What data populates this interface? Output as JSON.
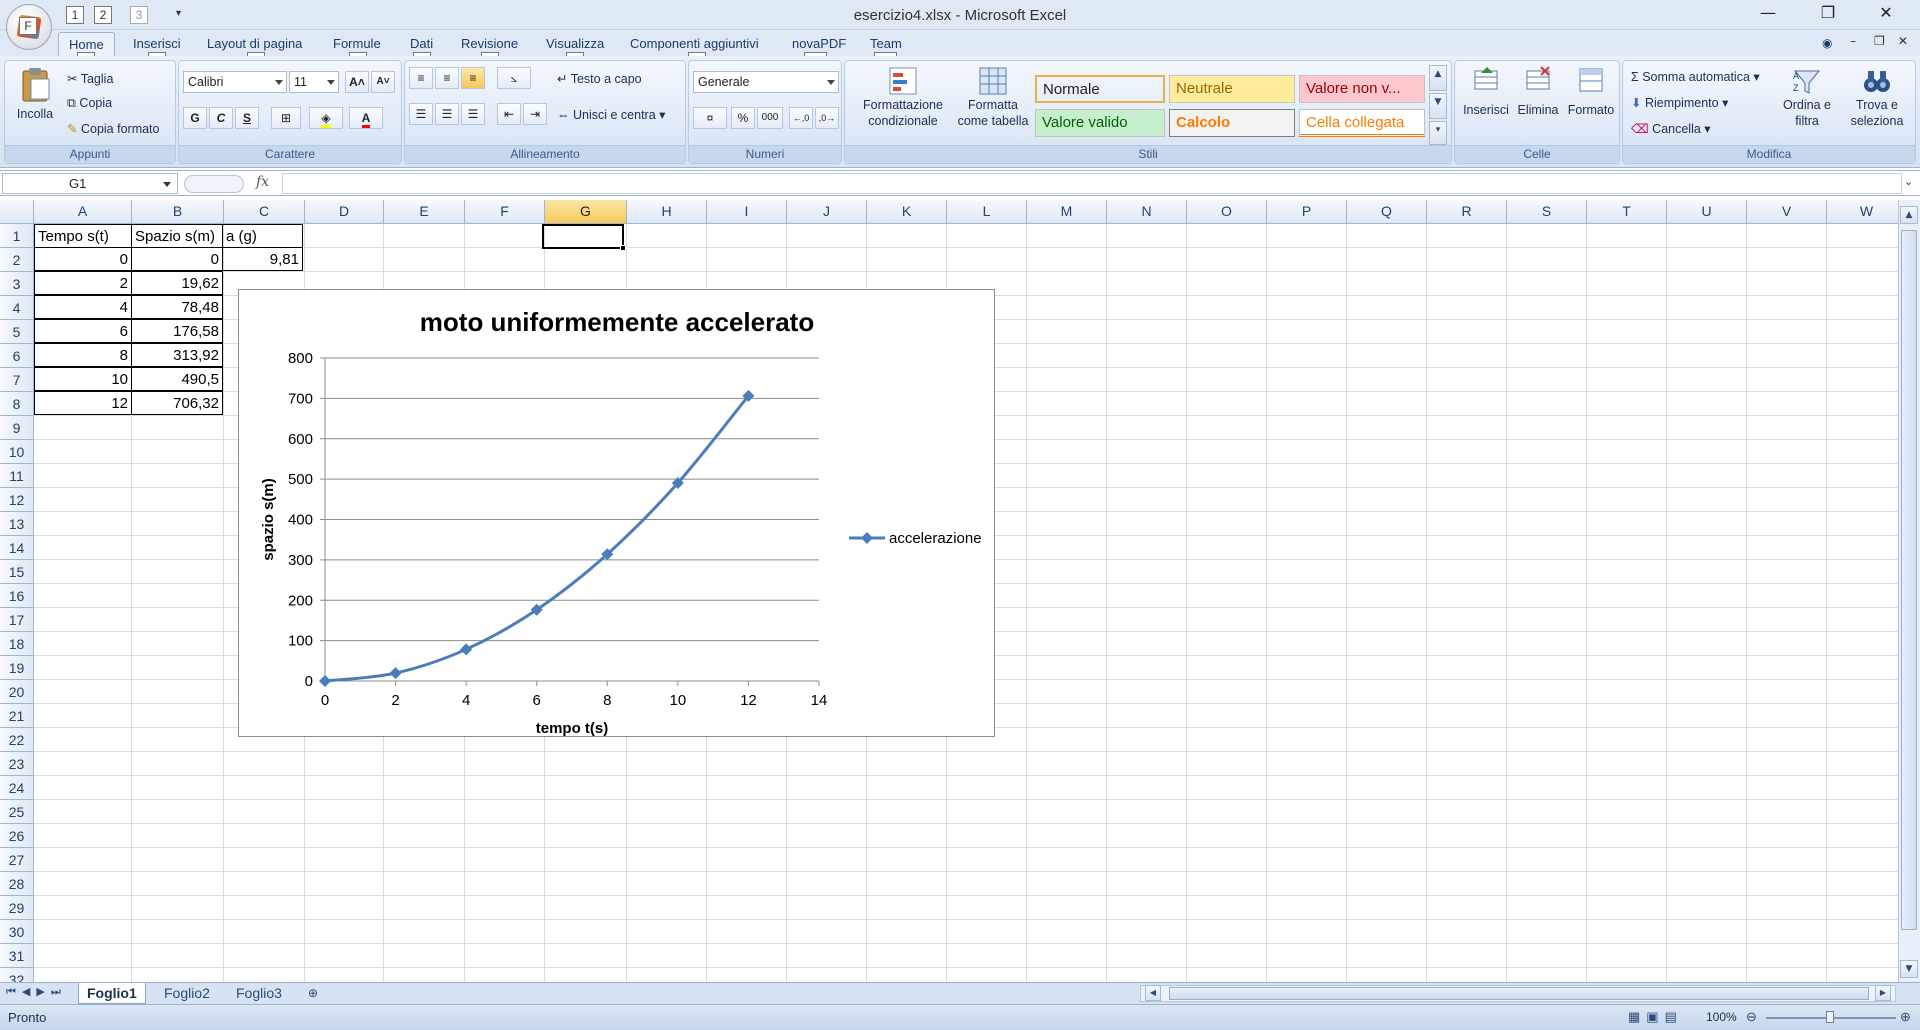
{
  "window": {
    "title": "esercizio4.xlsx - Microsoft Excel",
    "office_keytip": "F",
    "qat_tips": [
      "1",
      "2",
      "3"
    ]
  },
  "tabs": [
    {
      "label": "Home",
      "tip": "H"
    },
    {
      "label": "Inserisci",
      "tip": "C"
    },
    {
      "label": "Layout di pagina",
      "tip": "P"
    },
    {
      "label": "Formule",
      "tip": "U"
    },
    {
      "label": "Dati",
      "tip": "A"
    },
    {
      "label": "Revisione",
      "tip": "R"
    },
    {
      "label": "Visualizza",
      "tip": "N"
    },
    {
      "label": "Componenti aggiuntivi",
      "tip": "T"
    },
    {
      "label": "novaPDF",
      "tip": "Y1"
    },
    {
      "label": "Team",
      "tip": "Y2"
    }
  ],
  "ribbon": {
    "appunti": {
      "label": "Appunti",
      "paste": "Incolla",
      "cut": "Taglia",
      "copy": "Copia",
      "format_painter": "Copia formato"
    },
    "carattere": {
      "label": "Carattere",
      "font": "Calibri",
      "size": "11",
      "bold": "G",
      "italic": "C",
      "underline": "S",
      "grow": "A",
      "shrink": "A"
    },
    "allineamento": {
      "label": "Allineamento",
      "wrap": "Testo a capo",
      "merge": "Unisci e centra"
    },
    "numeri": {
      "label": "Numeri",
      "format": "Generale",
      "percent": "%",
      "thousands": "000"
    },
    "stili": {
      "label": "Stili",
      "conditional": "Formattazione condizionale",
      "as_table": "Formatta come tabella",
      "styles": [
        {
          "name": "Normale",
          "bg": "#ffffff",
          "color": "#000000"
        },
        {
          "name": "Neutrale",
          "bg": "#ffeb9c",
          "color": "#9c6500"
        },
        {
          "name": "Valore non v...",
          "bg": "#ffc7ce",
          "color": "#9c0006"
        },
        {
          "name": "Valore valido",
          "bg": "#c6efce",
          "color": "#006100"
        },
        {
          "name": "Calcolo",
          "bg": "#f2f2f2",
          "color": "#fa7d00"
        },
        {
          "name": "Cella collegata",
          "bg": "#ffffff",
          "color": "#fa7d00"
        }
      ]
    },
    "celle": {
      "label": "Celle",
      "insert": "Inserisci",
      "delete": "Elimina",
      "format": "Formato"
    },
    "modifica": {
      "label": "Modifica",
      "autosum": "Somma automatica",
      "fill": "Riempimento",
      "clear": "Cancella",
      "sort": "Ordina e filtra",
      "find": "Trova e seleziona"
    }
  },
  "formula_bar": {
    "name_box": "G1",
    "fx": "fx",
    "content": ""
  },
  "columns": [
    "A",
    "B",
    "C",
    "D",
    "E",
    "F",
    "G",
    "H",
    "I",
    "J",
    "K",
    "L",
    "M",
    "N",
    "O",
    "P",
    "Q",
    "R",
    "S",
    "T",
    "U",
    "V",
    "W"
  ],
  "selected_column": "G",
  "rows": [
    "1",
    "2",
    "3",
    "4",
    "5",
    "6",
    "7",
    "8",
    "9",
    "10",
    "11",
    "12",
    "13",
    "14",
    "15",
    "16",
    "17",
    "18",
    "19",
    "20",
    "21",
    "22",
    "23",
    "24",
    "25",
    "26",
    "27",
    "28",
    "29",
    "30",
    "31",
    "32"
  ],
  "sheet": {
    "headers": [
      "Tempo s(t)",
      "Spazio s(m)",
      "a (g)"
    ],
    "g": "9,81",
    "table": [
      [
        "0",
        "0"
      ],
      [
        "2",
        "19,62"
      ],
      [
        "4",
        "78,48"
      ],
      [
        "6",
        "176,58"
      ],
      [
        "8",
        "313,92"
      ],
      [
        "10",
        "490,5"
      ],
      [
        "12",
        "706,32"
      ]
    ]
  },
  "chart_data": {
    "type": "line",
    "title": "moto uniformemente accelerato",
    "xlabel": "tempo t(s)",
    "ylabel": "spazio s(m)",
    "x": [
      0,
      2,
      4,
      6,
      8,
      10,
      12
    ],
    "series": [
      {
        "name": "accelerazione",
        "values": [
          0,
          19.62,
          78.48,
          176.58,
          313.92,
          490.5,
          706.32
        ],
        "color": "#4a7ebb"
      }
    ],
    "xlim": [
      0,
      14
    ],
    "ylim": [
      0,
      800
    ],
    "xticks": [
      "0",
      "2",
      "4",
      "6",
      "8",
      "10",
      "12",
      "14"
    ],
    "yticks": [
      "0",
      "100",
      "200",
      "300",
      "400",
      "500",
      "600",
      "700",
      "800"
    ],
    "grid": "horizontal",
    "legend": "right"
  },
  "sheet_tabs": [
    "Foglio1",
    "Foglio2",
    "Foglio3"
  ],
  "active_sheet": "Foglio1",
  "status": {
    "text": "Pronto",
    "zoom": "100%"
  }
}
